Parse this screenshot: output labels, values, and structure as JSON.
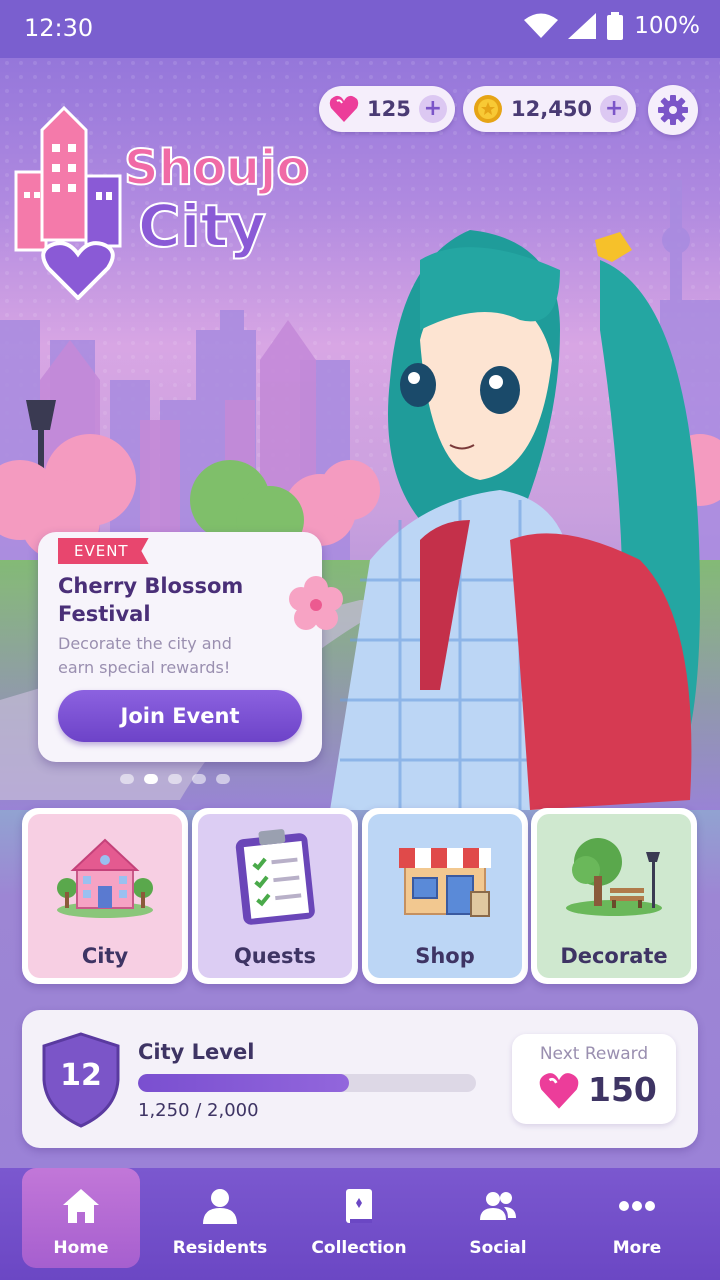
{
  "status_bar": {
    "time": "12:30",
    "battery": "100%"
  },
  "currency": {
    "gems": "125",
    "coins": "12,450"
  },
  "logo": {
    "line1": "Shoujo",
    "line2": "City"
  },
  "event": {
    "tag": "EVENT",
    "title": "Cherry Blossom Festival",
    "description": "Decorate the city and earn special rewards!",
    "button": "Join Event",
    "carousel_pages": 5,
    "carousel_active": 1
  },
  "tiles": [
    {
      "label": "City",
      "color": "#f7cfe3"
    },
    {
      "label": "Quests",
      "color": "#dccdf3"
    },
    {
      "label": "Shop",
      "color": "#bcd6f5"
    },
    {
      "label": "Decorate",
      "color": "#cfe8cf"
    }
  ],
  "level": {
    "title": "City Level",
    "number": "12",
    "progress_text": "1,250 / 2,000",
    "progress_fraction": 0.625,
    "reward_label": "Next Reward",
    "reward_value": "150"
  },
  "nav": [
    {
      "label": "Home",
      "icon": "home-icon",
      "active": true
    },
    {
      "label": "Residents",
      "icon": "person-icon",
      "active": false
    },
    {
      "label": "Collection",
      "icon": "book-icon",
      "active": false
    },
    {
      "label": "Social",
      "icon": "people-icon",
      "active": false
    },
    {
      "label": "More",
      "icon": "more-icon",
      "active": false
    }
  ],
  "colors": {
    "accent": "#7b55c8",
    "pink": "#f06aa6",
    "event_tag": "#e8466e"
  }
}
